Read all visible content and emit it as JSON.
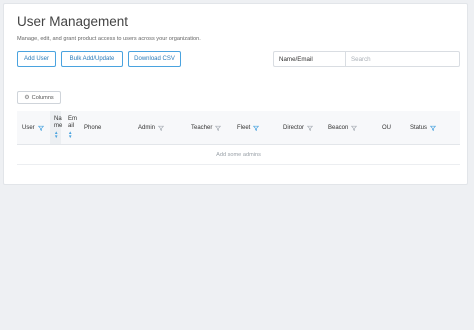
{
  "header": {
    "title": "User Management",
    "subtitle": "Manage, edit, and grant product access to users across your organization."
  },
  "toolbar": {
    "add_user": "Add User",
    "bulk_add": "Bulk Add/Update",
    "download_csv": "Download CSV"
  },
  "search": {
    "field_selected": "Name/Email",
    "placeholder": "Search"
  },
  "columns_button": "Columns",
  "table": {
    "headers": {
      "user": "User",
      "name_line1": "Na",
      "name_line2": "me",
      "email_line1": "Em",
      "email_line2": "ail",
      "phone": "Phone",
      "admin": "Admin",
      "teacher": "Teacher",
      "fleet": "Fleet",
      "director": "Director",
      "beacon": "Beacon",
      "ou": "OU",
      "status": "Status"
    },
    "empty_message": "Add some admins"
  },
  "colors": {
    "accent": "#4aa3df",
    "filter_active": "#4aa3df",
    "filter_inactive": "#a7adb4"
  }
}
